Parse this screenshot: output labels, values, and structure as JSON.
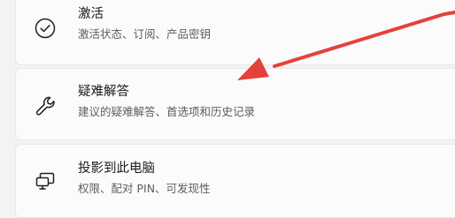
{
  "settings": {
    "items": [
      {
        "title": "激活",
        "subtitle": "激活状态、订阅、产品密钥",
        "icon": "check-circle-icon"
      },
      {
        "title": "疑难解答",
        "subtitle": "建议的疑难解答、首选项和历史记录",
        "icon": "wrench-icon"
      },
      {
        "title": "投影到此电脑",
        "subtitle": "权限、配对 PIN、可发现性",
        "icon": "project-to-pc-icon"
      }
    ]
  },
  "annotation": {
    "arrow_color": "#e5413a"
  }
}
